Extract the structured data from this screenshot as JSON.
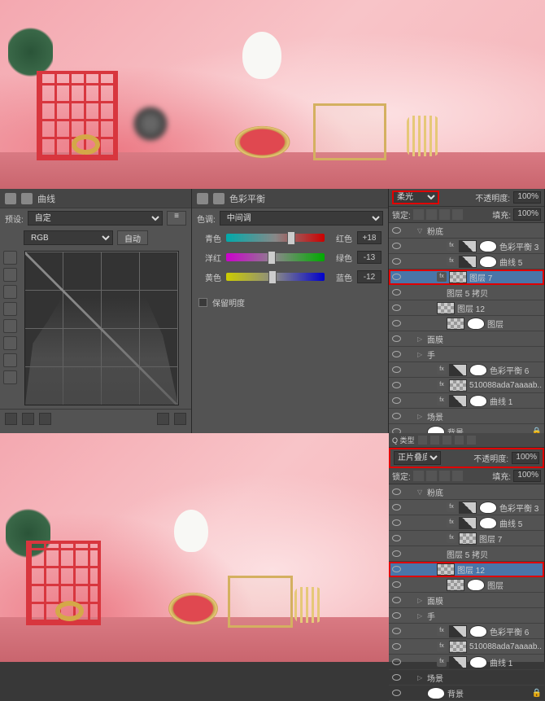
{
  "curves": {
    "title": "曲线",
    "preset_label": "预设:",
    "preset_value": "自定",
    "channel": "RGB",
    "auto_btn": "自动"
  },
  "colorBalance": {
    "title": "色彩平衡",
    "tone_label": "色调:",
    "tone_value": "中间调",
    "sliders": [
      {
        "left": "青色",
        "right": "红色",
        "value": "+18"
      },
      {
        "left": "洋红",
        "right": "绿色",
        "value": "-13"
      },
      {
        "left": "黄色",
        "right": "蓝色",
        "value": "-12"
      }
    ],
    "preserve": "保留明度"
  },
  "layersTop": {
    "blend_mode": "柔光",
    "opacity_label": "不透明度:",
    "opacity_value": "100%",
    "lock_label": "锁定:",
    "fill_label": "填充:",
    "fill_value": "100%",
    "layers": [
      {
        "indent": 1,
        "chev": "▽",
        "name": "粉底",
        "thumb": "none"
      },
      {
        "indent": 3,
        "name": "色彩平衡 3",
        "thumb": "adj",
        "fx": true,
        "mask": true
      },
      {
        "indent": 3,
        "name": "曲线 5",
        "thumb": "adj",
        "fx": true,
        "mask": true
      },
      {
        "indent": 2,
        "name": "图层 7",
        "thumb": "chk",
        "sel": true,
        "hl": true,
        "fx": true
      },
      {
        "indent": 3,
        "name": "图层 5 拷贝",
        "thumb": "none"
      },
      {
        "indent": 2,
        "name": "图层 12",
        "thumb": "chk"
      },
      {
        "indent": 3,
        "name": "图层",
        "thumb": "chk",
        "mask": true
      },
      {
        "indent": 1,
        "chev": "▷",
        "name": "面膜",
        "thumb": "none"
      },
      {
        "indent": 1,
        "chev": "▷",
        "name": "手",
        "thumb": "none"
      },
      {
        "indent": 2,
        "name": "色彩平衡 6",
        "thumb": "adj",
        "fx": true,
        "mask": true
      },
      {
        "indent": 2,
        "name": "510088ada7aaaab...",
        "thumb": "chk",
        "fx": true
      },
      {
        "indent": 2,
        "name": "曲线 1",
        "thumb": "adj",
        "fx": true,
        "mask": true
      },
      {
        "indent": 1,
        "chev": "▷",
        "name": "场景",
        "thumb": "none"
      },
      {
        "indent": 1,
        "name": "背景",
        "thumb": "mask",
        "lock": true
      }
    ]
  },
  "layersBottom": {
    "kind_label": "Q 类型",
    "blend_mode": "正片叠底",
    "opacity_label": "不透明度:",
    "opacity_value": "100%",
    "lock_label": "锁定:",
    "fill_label": "填充:",
    "fill_value": "100%",
    "layers": [
      {
        "indent": 1,
        "chev": "▽",
        "name": "粉底",
        "thumb": "none"
      },
      {
        "indent": 3,
        "name": "色彩平衡 3",
        "thumb": "adj",
        "fx": true,
        "mask": true
      },
      {
        "indent": 3,
        "name": "曲线 5",
        "thumb": "adj",
        "fx": true,
        "mask": true
      },
      {
        "indent": 3,
        "name": "图层 7",
        "thumb": "chk",
        "fx": true
      },
      {
        "indent": 3,
        "name": "图层 5 拷贝",
        "thumb": "none"
      },
      {
        "indent": 2,
        "name": "图层 12",
        "thumb": "chk",
        "sel": true,
        "hl": true
      },
      {
        "indent": 3,
        "name": "图层",
        "thumb": "chk",
        "mask": true
      },
      {
        "indent": 1,
        "chev": "▷",
        "name": "面膜",
        "thumb": "none"
      },
      {
        "indent": 1,
        "chev": "▷",
        "name": "手",
        "thumb": "none"
      },
      {
        "indent": 2,
        "name": "色彩平衡 6",
        "thumb": "adj",
        "fx": true,
        "mask": true
      },
      {
        "indent": 2,
        "name": "510088ada7aaaab...",
        "thumb": "chk",
        "fx": true
      },
      {
        "indent": 2,
        "name": "曲线 1",
        "thumb": "adj",
        "fx": true,
        "mask": true
      },
      {
        "indent": 1,
        "chev": "▷",
        "name": "场景",
        "thumb": "none"
      },
      {
        "indent": 1,
        "name": "背景",
        "thumb": "mask",
        "lock": true
      }
    ]
  }
}
